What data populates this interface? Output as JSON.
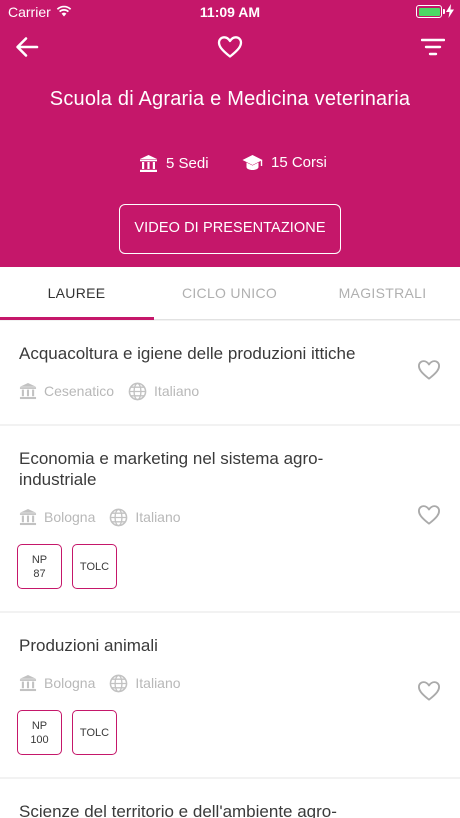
{
  "status": {
    "carrier": "Carrier",
    "time": "11:09 AM"
  },
  "header": {
    "title": "Scuola di Agraria e Medicina veterinaria",
    "sedi": "5 Sedi",
    "corsi": "15 Corsi",
    "video_button": "VIDEO DI PRESENTAZIONE",
    "color": "#c5176a"
  },
  "nav": {
    "back_icon": "arrow-left-icon",
    "favorite_icon": "heart-outline-icon",
    "filter_icon": "filter-icon"
  },
  "tabs": [
    {
      "label": "LAUREE",
      "active": true
    },
    {
      "label": "CICLO UNICO",
      "active": false
    },
    {
      "label": "MAGISTRALI",
      "active": false
    }
  ],
  "courses": [
    {
      "title": "Acquacoltura e igiene delle produzioni ittiche",
      "city": "Cesenatico",
      "language": "Italiano",
      "badges": []
    },
    {
      "title": "Economia e marketing nel sistema agro-industriale",
      "city": "Bologna",
      "language": "Italiano",
      "badges": [
        {
          "line1": "NP",
          "line2": "87"
        },
        {
          "line1": "TOLC",
          "line2": ""
        }
      ]
    },
    {
      "title": "Produzioni animali",
      "city": "Bologna",
      "language": "Italiano",
      "badges": [
        {
          "line1": "NP",
          "line2": "100"
        },
        {
          "line1": "TOLC",
          "line2": ""
        }
      ]
    },
    {
      "title": "Scienze del territorio e dell'ambiente agro-",
      "city": "",
      "language": "",
      "badges": []
    }
  ]
}
